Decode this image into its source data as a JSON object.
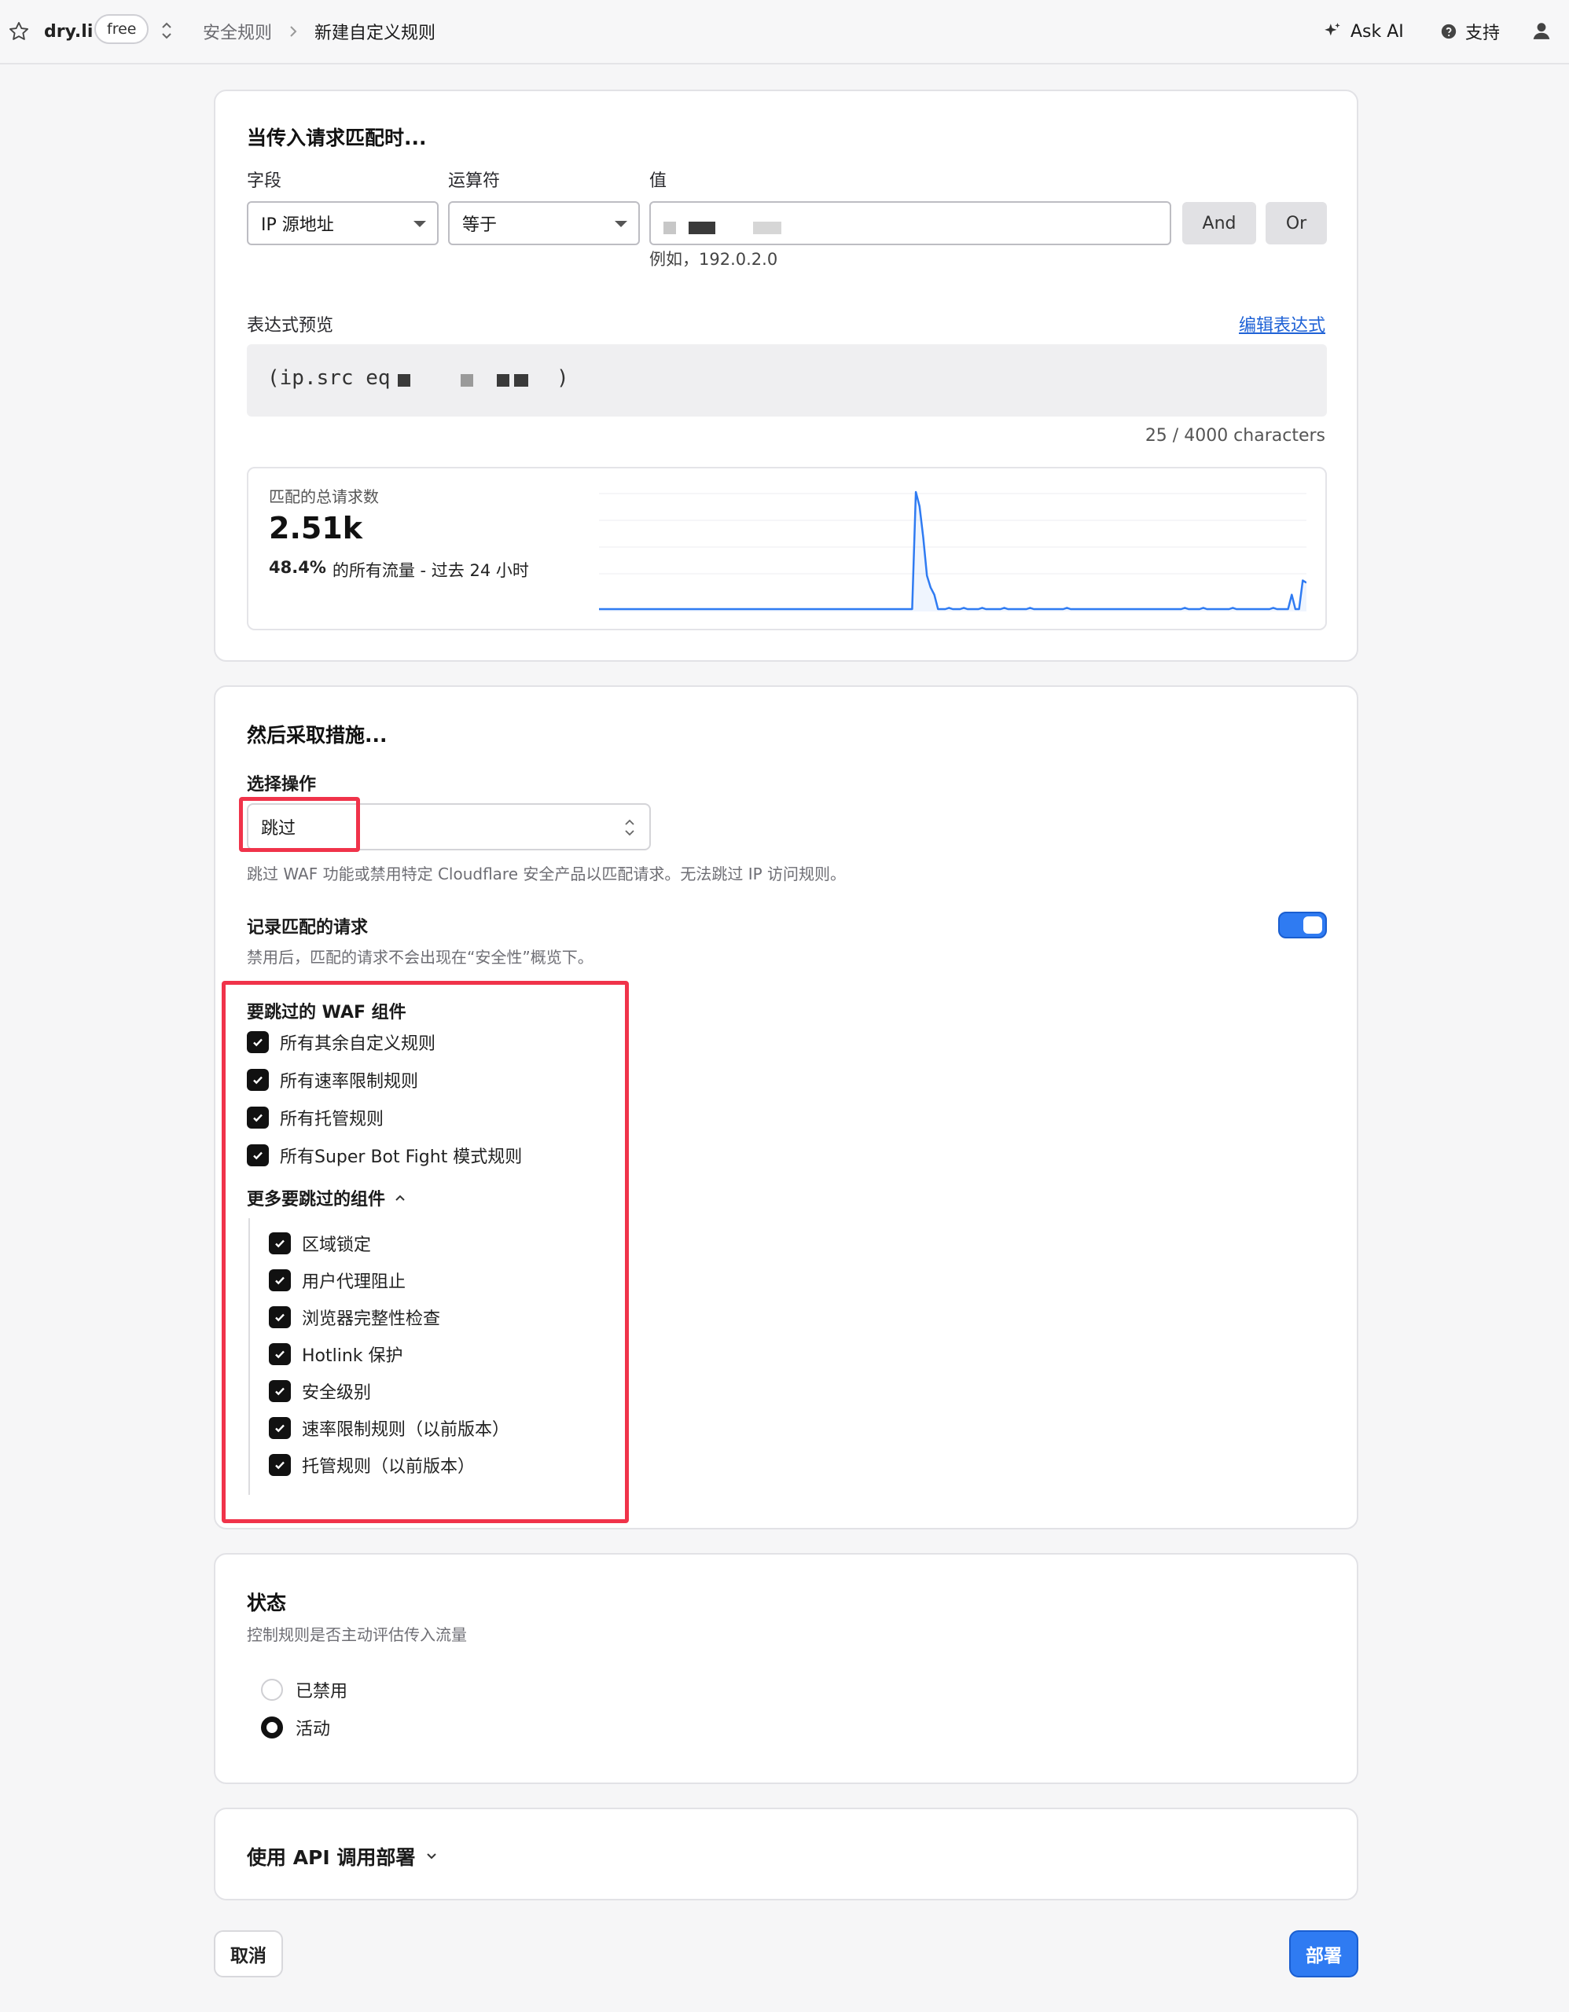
{
  "topbar": {
    "site": "dry.li",
    "plan": "free",
    "breadcrumb": [
      "安全规则",
      "新建自定义规则"
    ],
    "ask_ai": "Ask AI",
    "support": "支持"
  },
  "match_card": {
    "title": "当传入请求匹配时...",
    "field_label": "字段",
    "operator_label": "运算符",
    "value_label": "值",
    "field_value": "IP 源地址",
    "operator_value": "等于",
    "value_hint": "例如，192.0.2.0",
    "and_label": "And",
    "or_label": "Or",
    "expression_label": "表达式预览",
    "edit_expression": "编辑表达式",
    "expression_prefix": "(ip.src eq",
    "expression_suffix": ")",
    "char_count": "25 / 4000 characters",
    "stats": {
      "label": "匹配的总请求数",
      "total": "2.51k",
      "percent": "48.4%",
      "suffix": "的所有流量 - 过去 24 小时"
    }
  },
  "chart_data": {
    "type": "line",
    "series": [
      {
        "values": [
          2,
          2,
          2,
          2,
          2,
          2,
          2,
          2,
          2,
          2,
          2,
          2,
          2,
          2,
          2,
          2,
          2,
          2,
          2,
          2,
          2,
          2,
          2,
          2,
          2,
          2,
          2,
          2,
          2,
          2,
          2,
          2,
          2,
          2,
          2,
          2,
          2,
          2,
          2,
          2,
          2,
          2,
          2,
          2,
          2,
          2,
          2,
          2,
          2,
          2,
          2,
          2,
          2,
          2,
          2,
          2,
          2,
          2,
          2,
          2,
          2,
          2,
          2,
          2,
          2,
          2,
          2,
          2,
          2,
          2,
          2,
          2,
          2,
          2,
          2,
          2,
          2,
          2,
          2,
          2,
          2,
          2,
          2,
          2,
          2,
          2,
          100,
          88,
          62,
          30,
          20,
          14,
          2,
          2,
          2,
          3,
          2,
          2,
          2,
          3,
          2,
          2,
          2,
          2,
          3,
          2,
          2,
          2,
          2,
          2,
          3,
          2,
          2,
          2,
          2,
          2,
          2,
          3,
          2,
          2,
          2,
          2,
          2,
          2,
          2,
          2,
          2,
          3,
          2,
          2,
          2,
          2,
          2,
          2,
          2,
          2,
          2,
          2,
          2,
          2,
          2,
          2,
          2,
          2,
          2,
          2,
          2,
          2,
          2,
          2,
          2,
          2,
          2,
          2,
          2,
          2,
          2,
          2,
          2,
          3,
          2,
          2,
          2,
          2,
          3,
          2,
          2,
          2,
          2,
          2,
          2,
          2,
          3,
          2,
          2,
          2,
          2,
          2,
          2,
          2,
          2,
          2,
          2,
          3,
          2,
          2,
          2,
          2,
          14,
          2,
          2,
          26,
          24
        ]
      }
    ],
    "color": "#2f7bf2"
  },
  "action_card": {
    "title": "然后采取措施...",
    "select_label": "选择操作",
    "select_value": "跳过",
    "select_help": "跳过 WAF 功能或禁用特定 Cloudflare 安全产品以匹配请求。无法跳过 IP 访问规则。",
    "log_label": "记录匹配的请求",
    "log_help": "禁用后，匹配的请求不会出现在“安全性”概览下。",
    "waf_title": "要跳过的 WAF 组件",
    "waf_items": [
      "所有其余自定义规则",
      "所有速率限制规则",
      "所有托管规则",
      "所有Super Bot Fight 模式规则"
    ],
    "more_label": "更多要跳过的组件",
    "more_items": [
      "区域锁定",
      "用户代理阻止",
      "浏览器完整性检查",
      "Hotlink 保护",
      "安全级别",
      "速率限制规则（以前版本）",
      "托管规则（以前版本）"
    ]
  },
  "status_card": {
    "title": "状态",
    "help": "控制规则是否主动评估传入流量",
    "options": [
      "已禁用",
      "活动"
    ],
    "selected": "活动"
  },
  "api_card": {
    "title": "使用 API 调用部署"
  },
  "footer": {
    "cancel": "取消",
    "deploy": "部署"
  },
  "colors": {
    "accent": "#2f7bf2",
    "highlight": "#f0334a"
  }
}
